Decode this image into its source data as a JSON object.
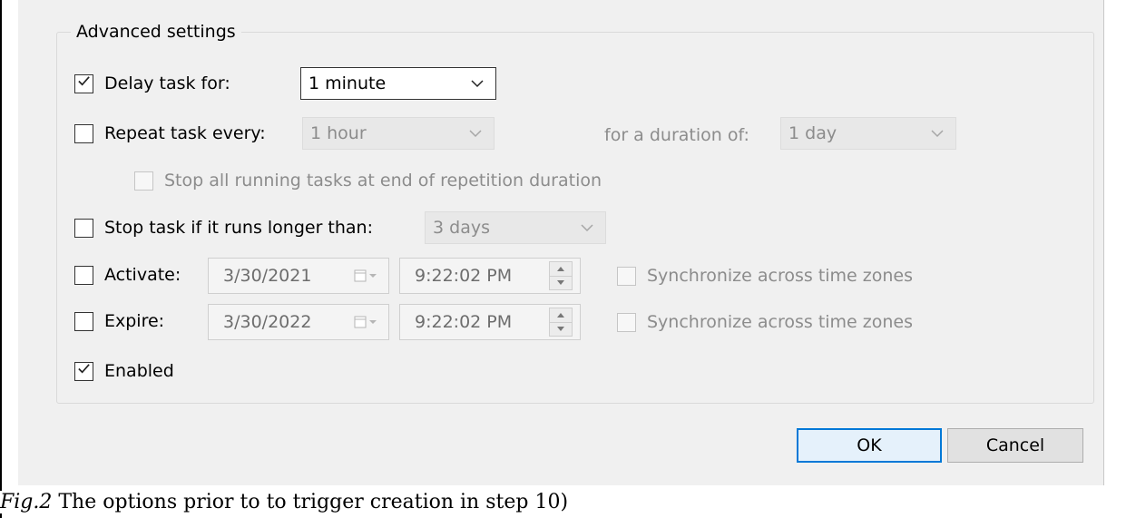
{
  "advanced_settings": {
    "group_title": "Advanced settings",
    "delay_task": {
      "label": "Delay task for:",
      "checked": true,
      "value": "1 minute"
    },
    "repeat_task": {
      "label": "Repeat task every:",
      "checked": false,
      "value": "1 hour",
      "duration_label": "for a duration of:",
      "duration_value": "1 day"
    },
    "stop_all_running": {
      "label": "Stop all running tasks at end of repetition duration",
      "checked": false
    },
    "stop_task": {
      "label": "Stop task if it runs longer than:",
      "checked": false,
      "value": "3 days"
    },
    "activate": {
      "label": "Activate:",
      "checked": false,
      "date": "3/30/2021",
      "time": "9:22:02 PM",
      "sync_label": "Synchronize across time zones"
    },
    "expire": {
      "label": "Expire:",
      "checked": false,
      "date": "3/30/2022",
      "time": "9:22:02 PM",
      "sync_label": "Synchronize across time zones"
    },
    "enabled": {
      "label": "Enabled",
      "checked": true
    }
  },
  "buttons": {
    "ok": "OK",
    "cancel": "Cancel"
  },
  "caption": {
    "figure": "Fig.2",
    "text": " The options prior to to trigger creation in step 10)"
  },
  "colors": {
    "dialog_bg": "#f0f0f0",
    "default_button_border": "#0078d7",
    "disabled_text": "#8c8c8c"
  }
}
